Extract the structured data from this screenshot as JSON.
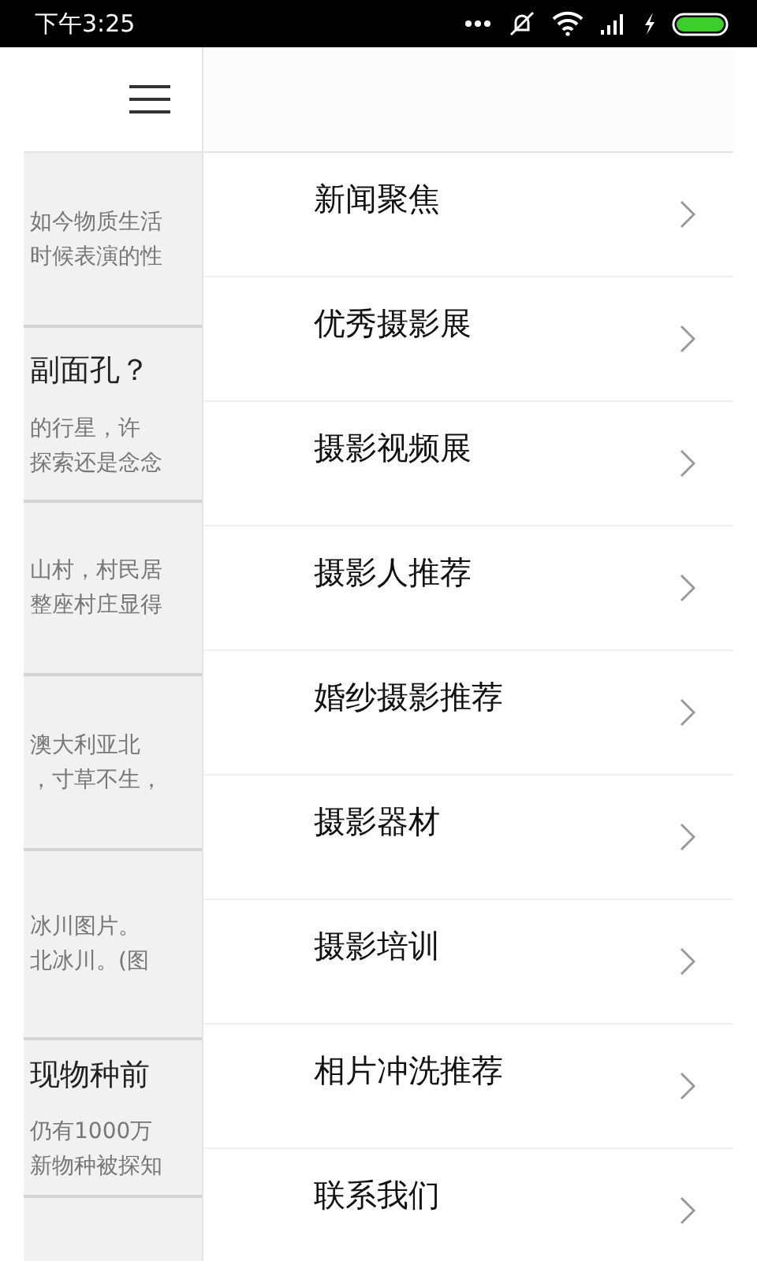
{
  "status_bar": {
    "time": "下午3:25"
  },
  "background_list": {
    "rows": [
      {
        "lines": [
          "如今物质生活",
          "时候表演的性"
        ]
      },
      {
        "title": "副面孔？",
        "lines": [
          "的行星，许",
          "探索还是念念"
        ]
      },
      {
        "lines": [
          "山村，村民居",
          "整座村庄显得"
        ]
      },
      {
        "lines": [
          "澳大利亚北",
          "，寸草不生，"
        ]
      },
      {
        "lines": [
          "冰川图片。",
          "北冰川。(图"
        ]
      },
      {
        "title": "现物种前",
        "lines": [
          "仍有1000万",
          "新物种被探知"
        ]
      }
    ]
  },
  "drawer": {
    "items": [
      {
        "label": "新闻聚焦"
      },
      {
        "label": "优秀摄影展"
      },
      {
        "label": "摄影视频展"
      },
      {
        "label": "摄影人推荐"
      },
      {
        "label": "婚纱摄影推荐"
      },
      {
        "label": "摄影器材"
      },
      {
        "label": "摄影培训"
      },
      {
        "label": "相片冲洗推荐"
      },
      {
        "label": "联系我们"
      }
    ]
  }
}
